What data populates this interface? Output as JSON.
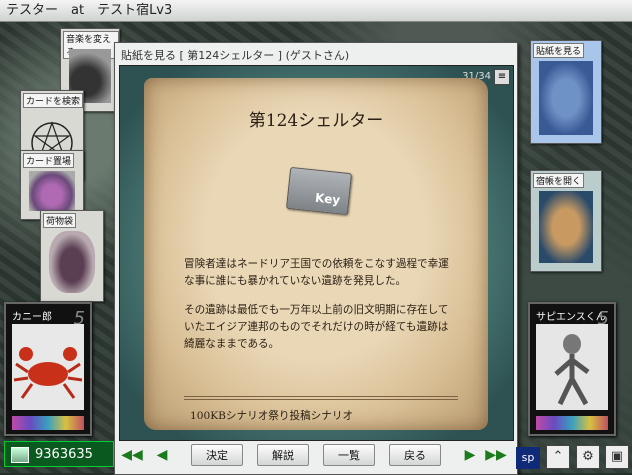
{
  "window": {
    "title": "テスター　at　テスト宿Lv3"
  },
  "left_cards": [
    {
      "label": "音楽を変える"
    },
    {
      "label": "カードを検索"
    },
    {
      "label": "カード置場"
    },
    {
      "label": "荷物袋"
    }
  ],
  "right_cards": [
    {
      "label": "貼紙を見る"
    },
    {
      "label": "宿帳を開く"
    }
  ],
  "characters": {
    "left": {
      "name": "カニー郎",
      "level": "5"
    },
    "right": {
      "name": "サピエンスくん",
      "level": "5"
    }
  },
  "dialog": {
    "title": "貼紙を見る [ 第124シェルター ] (ゲストさん)",
    "page": "31/34",
    "heading": "第124シェルター",
    "key_label": "Key",
    "paragraphs": [
      "冒険者達はネードリア王国での依頼をこなす過程で幸運な事に誰にも暴かれていない遺跡を発見した。",
      "その遺跡は最低でも一万年以上前の旧文明期に存在していたエイジア連邦のものでそれだけの時が経ても遺跡は綺麗なままである。"
    ],
    "footer": "100KBシナリオ祭り投稿シナリオ",
    "buttons": {
      "ok": "決定",
      "explain": "解説",
      "list": "一覧",
      "back": "戻る"
    }
  },
  "status": {
    "gold": "9363635",
    "sp_label": "sp"
  },
  "colors": {
    "arrow": "#1b7a1b",
    "gold_bg": "#0a5a20"
  }
}
